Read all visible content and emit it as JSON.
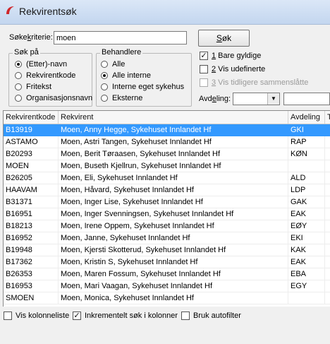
{
  "window": {
    "title": "Rekvirentsøk"
  },
  "search": {
    "label_prefix": "Søke",
    "label_underlined": "k",
    "label_suffix": "riterie:",
    "value": "moen",
    "button_underlined": "S",
    "button_rest": "øk"
  },
  "search_on": {
    "legend": "Søk på",
    "options": [
      {
        "label": "(Etter)-navn",
        "selected": true
      },
      {
        "label": "Rekvirentkode",
        "selected": false
      },
      {
        "label": "Fritekst",
        "selected": false
      },
      {
        "label": "Organisasjonsnavn",
        "selected": false
      }
    ]
  },
  "handlers": {
    "legend": "Behandlere",
    "options": [
      {
        "label": "Alle",
        "selected": false
      },
      {
        "label": "Alle interne",
        "selected": true
      },
      {
        "label": "Interne eget sykehus",
        "selected": false
      },
      {
        "label": "Eksterne",
        "selected": false
      }
    ]
  },
  "options": {
    "only_valid": {
      "underlined": "1",
      "label": " Bare gyldige",
      "checked": true
    },
    "show_undefined": {
      "underlined": "2",
      "label": " Vis udefinerte",
      "checked": false
    },
    "show_merged": {
      "underlined": "3",
      "label": " Vis tidligere sammenslåtte",
      "checked": false,
      "disabled": true
    }
  },
  "department": {
    "label_prefix": "Avd",
    "label_underlined": "e",
    "label_suffix": "ling:",
    "value": ""
  },
  "table": {
    "columns": [
      "Rekvirentkode",
      "Rekvirent",
      "Avdeling",
      "T"
    ],
    "rows": [
      {
        "code": "B13919",
        "name": "Moen, Anny Hegge, Sykehuset Innlandet Hf",
        "dept": "GKI"
      },
      {
        "code": "ASTAMO",
        "name": "Moen, Astri Tangen, Sykehuset Innlandet Hf",
        "dept": "RAP"
      },
      {
        "code": "B20293",
        "name": "Moen, Berit Tøraasen, Sykehuset Innlandet Hf",
        "dept": "KØN"
      },
      {
        "code": "MOEN",
        "name": "Moen, Buseth Kjellrun, Sykehuset Innlandet Hf",
        "dept": ""
      },
      {
        "code": "B26205",
        "name": "Moen, Eli, Sykehuset Innlandet Hf",
        "dept": "ALD"
      },
      {
        "code": "HAAVAM",
        "name": "Moen, Håvard, Sykehuset Innlandet Hf",
        "dept": "LDP"
      },
      {
        "code": "B31371",
        "name": "Moen, Inger Lise, Sykehuset Innlandet Hf",
        "dept": "GAK"
      },
      {
        "code": "B16951",
        "name": "Moen, Inger Svenningsen, Sykehuset Innlandet Hf",
        "dept": "EAK"
      },
      {
        "code": "B18213",
        "name": "Moen, Irene Oppem, Sykehuset Innlandet Hf",
        "dept": "EØY"
      },
      {
        "code": "B16952",
        "name": "Moen, Janne, Sykehuset Innlandet Hf",
        "dept": "EKI"
      },
      {
        "code": "B19948",
        "name": "Moen, Kjersti Skotterud, Sykehuset Innlandet Hf",
        "dept": "KAK"
      },
      {
        "code": "B17362",
        "name": "Moen, Kristin S, Sykehuset Innlandet Hf",
        "dept": "EAK"
      },
      {
        "code": "B26353",
        "name": "Moen, Maren Fossum, Sykehuset Innlandet Hf",
        "dept": "EBA"
      },
      {
        "code": "B16953",
        "name": "Moen, Mari Vaagan, Sykehuset Innlandet Hf",
        "dept": "EGY"
      },
      {
        "code": "SMOEN",
        "name": "Moen, Monica, Sykehuset Innlandet Hf",
        "dept": ""
      }
    ],
    "selected_index": 0
  },
  "footer": {
    "show_column_list": {
      "label": "Vis kolonneliste",
      "checked": false
    },
    "incremental_search": {
      "label": "Inkrementelt søk i kolonner",
      "checked": true
    },
    "use_autofilter": {
      "label": "Bruk autofilter",
      "checked": false
    }
  },
  "colors": {
    "selection": "#3399ff",
    "app_icon": "#d0262a"
  }
}
